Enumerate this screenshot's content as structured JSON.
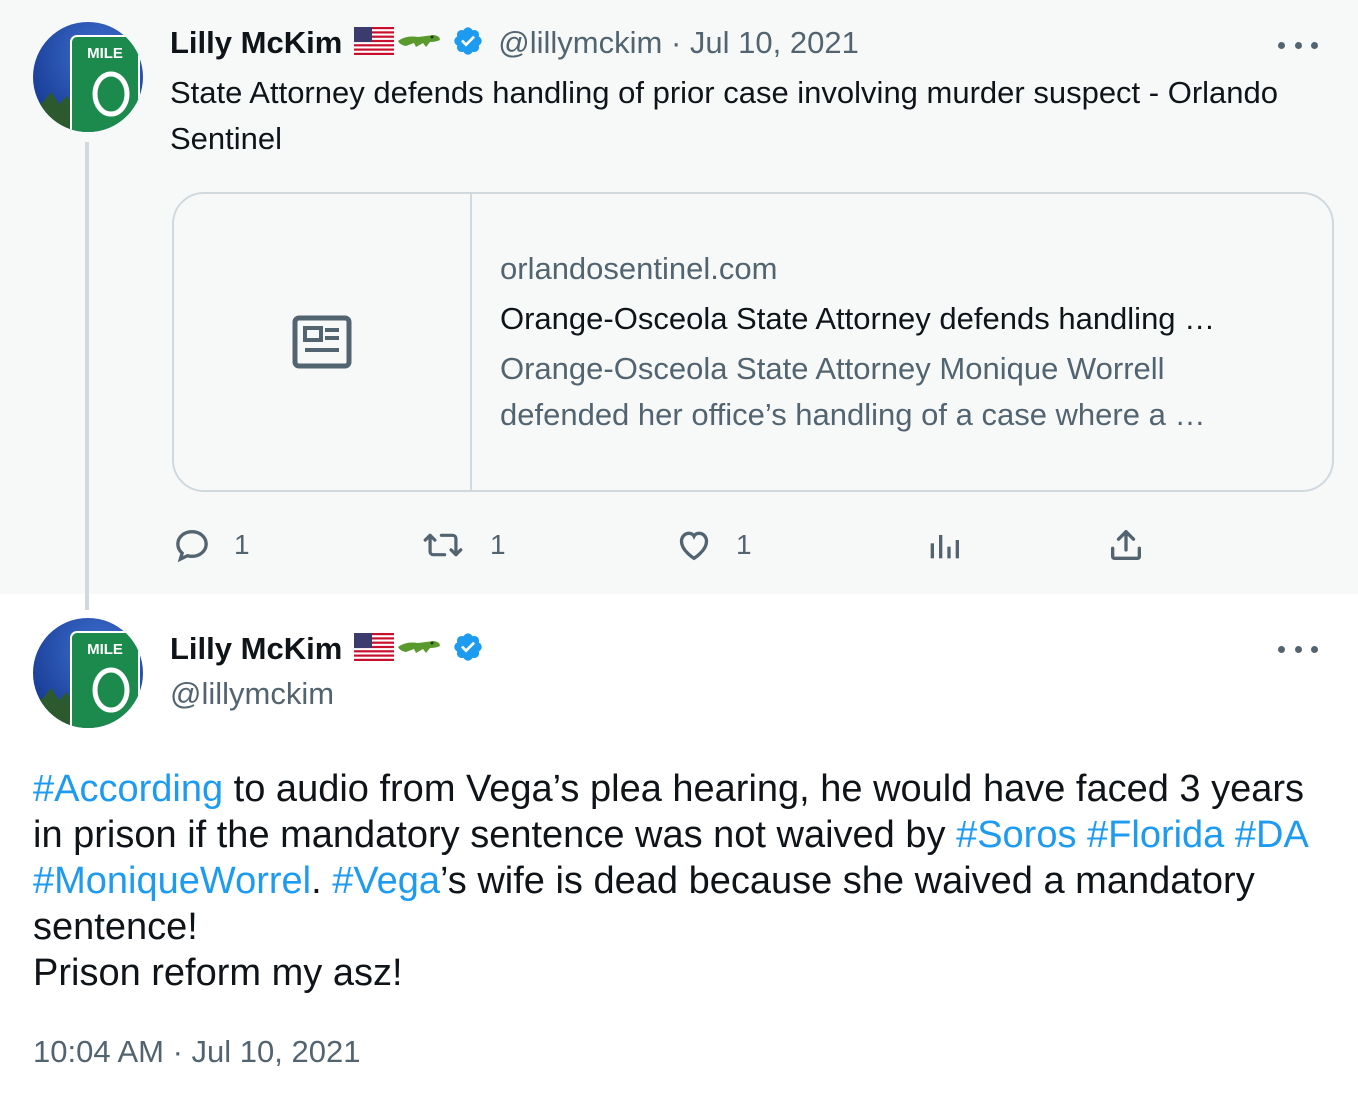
{
  "parent_tweet": {
    "display_name": "Lilly McKim",
    "handle": "@lillymckim",
    "separator": "·",
    "date": "Jul 10, 2021",
    "text": "State Attorney defends handling of prior case involving murder suspect - Orlando Sentinel",
    "avatar_sign_text": "MILE",
    "avatar_sign_number": "0",
    "card": {
      "domain": "orlandosentinel.com",
      "title": "Orange-Osceola State Attorney defends handling …",
      "description": "Orange-Osceola State Attorney Monique Worrell defended her office’s handling of a case where a …",
      "thumbnail_icon": "newspaper-icon"
    },
    "actions": {
      "reply_count": "1",
      "retweet_count": "1",
      "like_count": "1"
    }
  },
  "main_tweet": {
    "display_name": "Lilly McKim",
    "handle": "@lillymckim",
    "avatar_sign_text": "MILE",
    "avatar_sign_number": "0",
    "text_segments": [
      {
        "text": "#According",
        "hashtag": true
      },
      {
        "text": " to audio from Vega’s plea hearing, he would have faced 3 years in prison if the mandatory sentence was not waived by ",
        "hashtag": false
      },
      {
        "text": "#Soros",
        "hashtag": true
      },
      {
        "text": " ",
        "hashtag": false
      },
      {
        "text": "#Florida",
        "hashtag": true
      },
      {
        "text": " ",
        "hashtag": false
      },
      {
        "text": "#DA",
        "hashtag": true
      },
      {
        "text": " ",
        "hashtag": false
      },
      {
        "text": "#MoniqueWorrel",
        "hashtag": true
      },
      {
        "text": ". ",
        "hashtag": false
      },
      {
        "text": "#Vega",
        "hashtag": true
      },
      {
        "text": "’s wife is dead because she waived a mandatory sentence!",
        "hashtag": false
      },
      {
        "text": "Prison reform my asz!",
        "hashtag": false
      }
    ],
    "timestamp": "10:04 AM · Jul 10, 2021"
  },
  "colors": {
    "link": "#1d9bf0",
    "secondary_text": "#536471",
    "primary_text": "#0f1419",
    "verified": "#1d9bf0",
    "parent_background": "#f7f9f9",
    "border": "#cfd9de"
  }
}
